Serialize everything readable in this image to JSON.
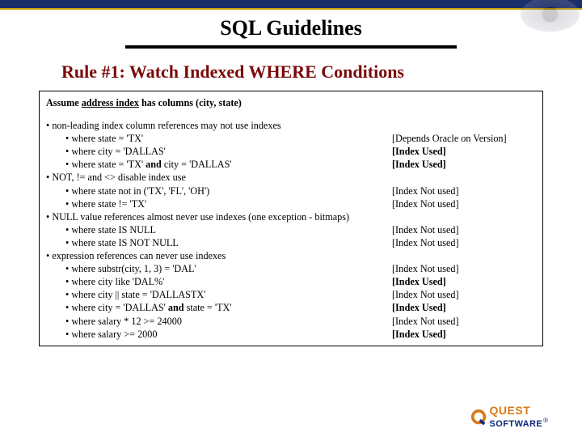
{
  "header": {
    "title": "SQL Guidelines",
    "rule": "Rule #1: Watch Indexed WHERE Conditions"
  },
  "assume": {
    "prefix": "Assume ",
    "underlined": "address index",
    "suffix": " has columns (city, state)"
  },
  "groups": [
    {
      "heading": "non-leading index column references may not use indexes",
      "items": [
        {
          "code": "where state = 'TX'",
          "note": "[Depends Oracle on Version]"
        },
        {
          "code": "where city = 'DALLAS'",
          "note": "[Index Used]",
          "bold_note": true
        },
        {
          "code": "where state = 'TX' ",
          "bold_mid": "and",
          "code_tail": " city = 'DALLAS'",
          "note": "[Index Used]",
          "bold_note": true
        }
      ]
    },
    {
      "heading": "NOT, != and <> disable index use",
      "items": [
        {
          "code": "where state not in ('TX', 'FL', 'OH')",
          "note": "[Index Not used]"
        },
        {
          "code": "where state != 'TX'",
          "note": "[Index Not used]"
        }
      ]
    },
    {
      "heading": "NULL value references almost never use indexes (one exception - bitmaps)",
      "items": [
        {
          "code": "where state IS NULL",
          "note": "[Index Not used]"
        },
        {
          "code": "where state IS NOT NULL",
          "note": "[Index Not used]"
        }
      ]
    },
    {
      "heading": "expression references can never use indexes",
      "items": [
        {
          "code": "where substr(city, 1, 3) = 'DAL'",
          "note": "[Index Not used]"
        },
        {
          "code": "where city like 'DAL%'",
          "note": "[Index Used]",
          "bold_note": true
        },
        {
          "code": "where city || state = 'DALLASTX'",
          "note": "[Index Not used]"
        },
        {
          "code": "where city = 'DALLAS' ",
          "bold_mid": "and",
          "code_tail": " state = 'TX'",
          "note": "[Index Used]",
          "bold_note": true
        },
        {
          "code": "where salary * 12 >= 24000",
          "note": "[Index Not used]"
        },
        {
          "code": "where salary >= 2000",
          "note": "[Index Used]",
          "bold_note": true
        }
      ]
    }
  ],
  "logo": {
    "line1": "QUEST",
    "line2": "SOFTWARE",
    "reg": "®"
  }
}
